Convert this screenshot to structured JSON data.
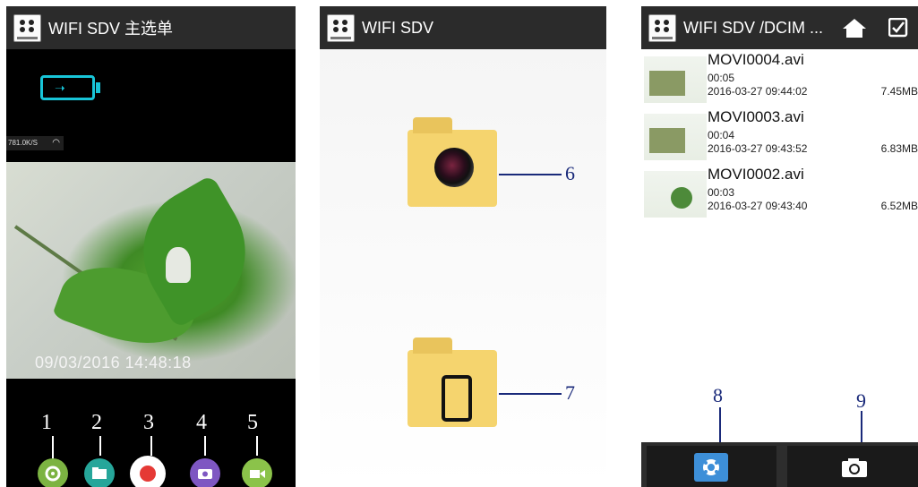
{
  "panel1": {
    "title": "WIFI SDV 主选单",
    "wifi_rate": "781.0K/S",
    "timestamp": "09/03/2016  14:48:18",
    "callouts": [
      "1",
      "2",
      "3",
      "4",
      "5"
    ],
    "icons": [
      "settings-icon",
      "folder-icon",
      "record-icon",
      "camera-icon",
      "video-icon"
    ],
    "colors": {
      "battery": "#18c5d8",
      "settings": "#7cb342",
      "folder": "#26a69a",
      "record": "#e53935",
      "camera": "#7e57c2",
      "video": "#8bc34a"
    }
  },
  "panel2": {
    "title": "WIFI SDV",
    "callouts": [
      "6",
      "7"
    ],
    "folders": [
      "camera-folder-icon",
      "phone-folder-icon"
    ]
  },
  "panel3": {
    "title": "WIFI SDV /DCIM ...",
    "files": [
      {
        "name": "MOVI0004.avi",
        "duration": "00:05",
        "datetime": "2016-03-27 09:44:02",
        "size": "7.45MB"
      },
      {
        "name": "MOVI0003.avi",
        "duration": "00:04",
        "datetime": "2016-03-27 09:43:52",
        "size": "6.83MB"
      },
      {
        "name": "MOVI0002.avi",
        "duration": "00:03",
        "datetime": "2016-03-27 09:43:40",
        "size": "6.52MB"
      }
    ],
    "callouts": [
      "8",
      "9"
    ],
    "tabs": [
      "video-tab-icon",
      "photo-tab-icon"
    ],
    "colors": {
      "active_tab": "#3d8fd8"
    }
  }
}
